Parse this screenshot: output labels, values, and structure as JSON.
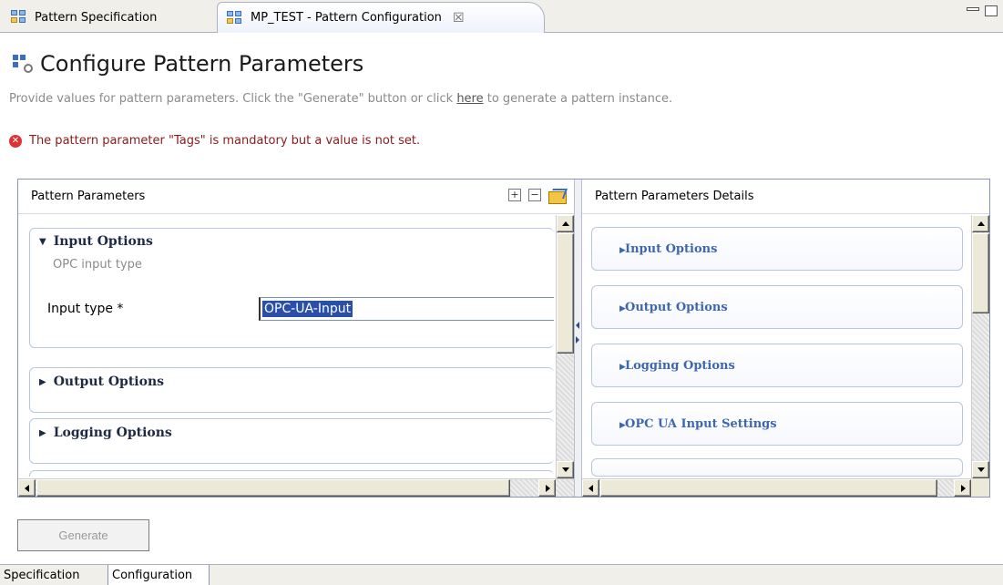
{
  "tabs": {
    "items": [
      {
        "label": "Pattern Specification"
      },
      {
        "label": "MP_TEST - Pattern Configuration"
      }
    ],
    "close_icon": "close-icon"
  },
  "header": {
    "title": "Configure Pattern Parameters",
    "description_prefix": "Provide values for pattern parameters. Click the \"Generate\" button or click ",
    "description_link": "here",
    "description_suffix": " to generate a pattern instance."
  },
  "error": {
    "message": "The pattern parameter \"Tags\" is mandatory but a value is not set."
  },
  "left_panel": {
    "title": "Pattern Parameters",
    "sections": [
      {
        "label": "Input Options",
        "expanded": true,
        "subtitle": "OPC input type"
      },
      {
        "label": "Output Options",
        "expanded": false
      },
      {
        "label": "Logging Options",
        "expanded": false
      }
    ],
    "field": {
      "label": "Input type *",
      "value": "OPC-UA-Input"
    },
    "tools": {
      "expand": "+",
      "collapse": "−"
    }
  },
  "right_panel": {
    "title": "Pattern Parameters Details",
    "sections": [
      {
        "label": "Input Options"
      },
      {
        "label": "Output Options"
      },
      {
        "label": "Logging Options"
      },
      {
        "label": "OPC UA Input Settings"
      }
    ]
  },
  "generate_button": {
    "label": "Generate",
    "enabled": false
  },
  "bottom_tabs": [
    {
      "label": "Specification"
    },
    {
      "label": "Configuration",
      "active": true
    }
  ]
}
